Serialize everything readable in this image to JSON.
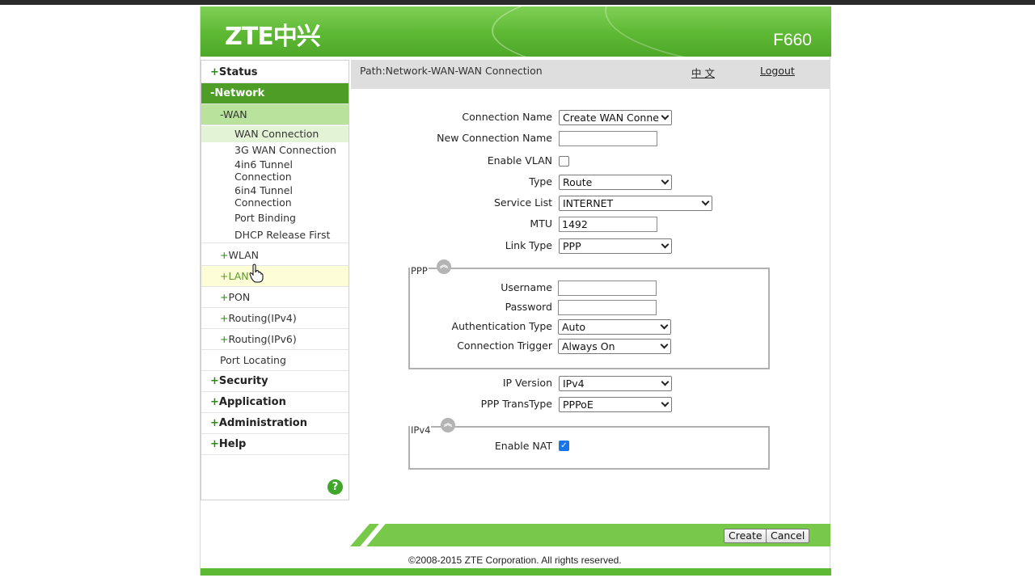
{
  "header": {
    "logo": "ZTE中兴",
    "model": "F660"
  },
  "sidebar": {
    "status": "Status",
    "network": "Network",
    "wan": "WAN",
    "wan_connection": "WAN Connection",
    "wan_3g": "3G WAN Connection",
    "tunnel_4in6_a": "4in6 Tunnel",
    "tunnel_4in6_b": "Connection",
    "tunnel_6in4_a": "6in4 Tunnel",
    "tunnel_6in4_b": "Connection",
    "port_binding": "Port Binding",
    "dhcp_release": "DHCP Release First",
    "wlan": "WLAN",
    "lan": "LAN",
    "pon": "PON",
    "routing_v4": "Routing(IPv4)",
    "routing_v6": "Routing(IPv6)",
    "port_locating": "Port Locating",
    "security": "Security",
    "application": "Application",
    "administration": "Administration",
    "help": "Help",
    "help_icon": "?"
  },
  "pathbar": {
    "path": "Path:Network-WAN-WAN Connection",
    "language": "中 文",
    "logout": "Logout"
  },
  "form": {
    "connection_name_label": "Connection Name",
    "connection_name_value": "Create WAN Conne",
    "new_connection_name_label": "New Connection Name",
    "new_connection_name_value": "",
    "enable_vlan_label": "Enable VLAN",
    "type_label": "Type",
    "type_value": "Route",
    "service_list_label": "Service List",
    "service_list_value": "INTERNET",
    "mtu_label": "MTU",
    "mtu_value": "1492",
    "link_type_label": "Link Type",
    "link_type_value": "PPP",
    "ppp_legend": "PPP",
    "username_label": "Username",
    "username_value": "",
    "password_label": "Password",
    "password_value": "",
    "auth_type_label": "Authentication Type",
    "auth_type_value": "Auto",
    "conn_trigger_label": "Connection Trigger",
    "conn_trigger_value": "Always On",
    "ip_version_label": "IP Version",
    "ip_version_value": "IPv4",
    "ppp_transtype_label": "PPP TransType",
    "ppp_transtype_value": "PPPoE",
    "ipv4_legend": "IPv4",
    "enable_nat_label": "Enable NAT",
    "collapse_glyph": "︽"
  },
  "footer": {
    "create": "Create",
    "cancel": "Cancel",
    "copyright": "©2008-2015 ZTE Corporation. All rights reserved."
  },
  "colors": {
    "brand_green": "#5db833",
    "nav_active": "#4d9d26",
    "nav_wan": "#b9e29d"
  }
}
